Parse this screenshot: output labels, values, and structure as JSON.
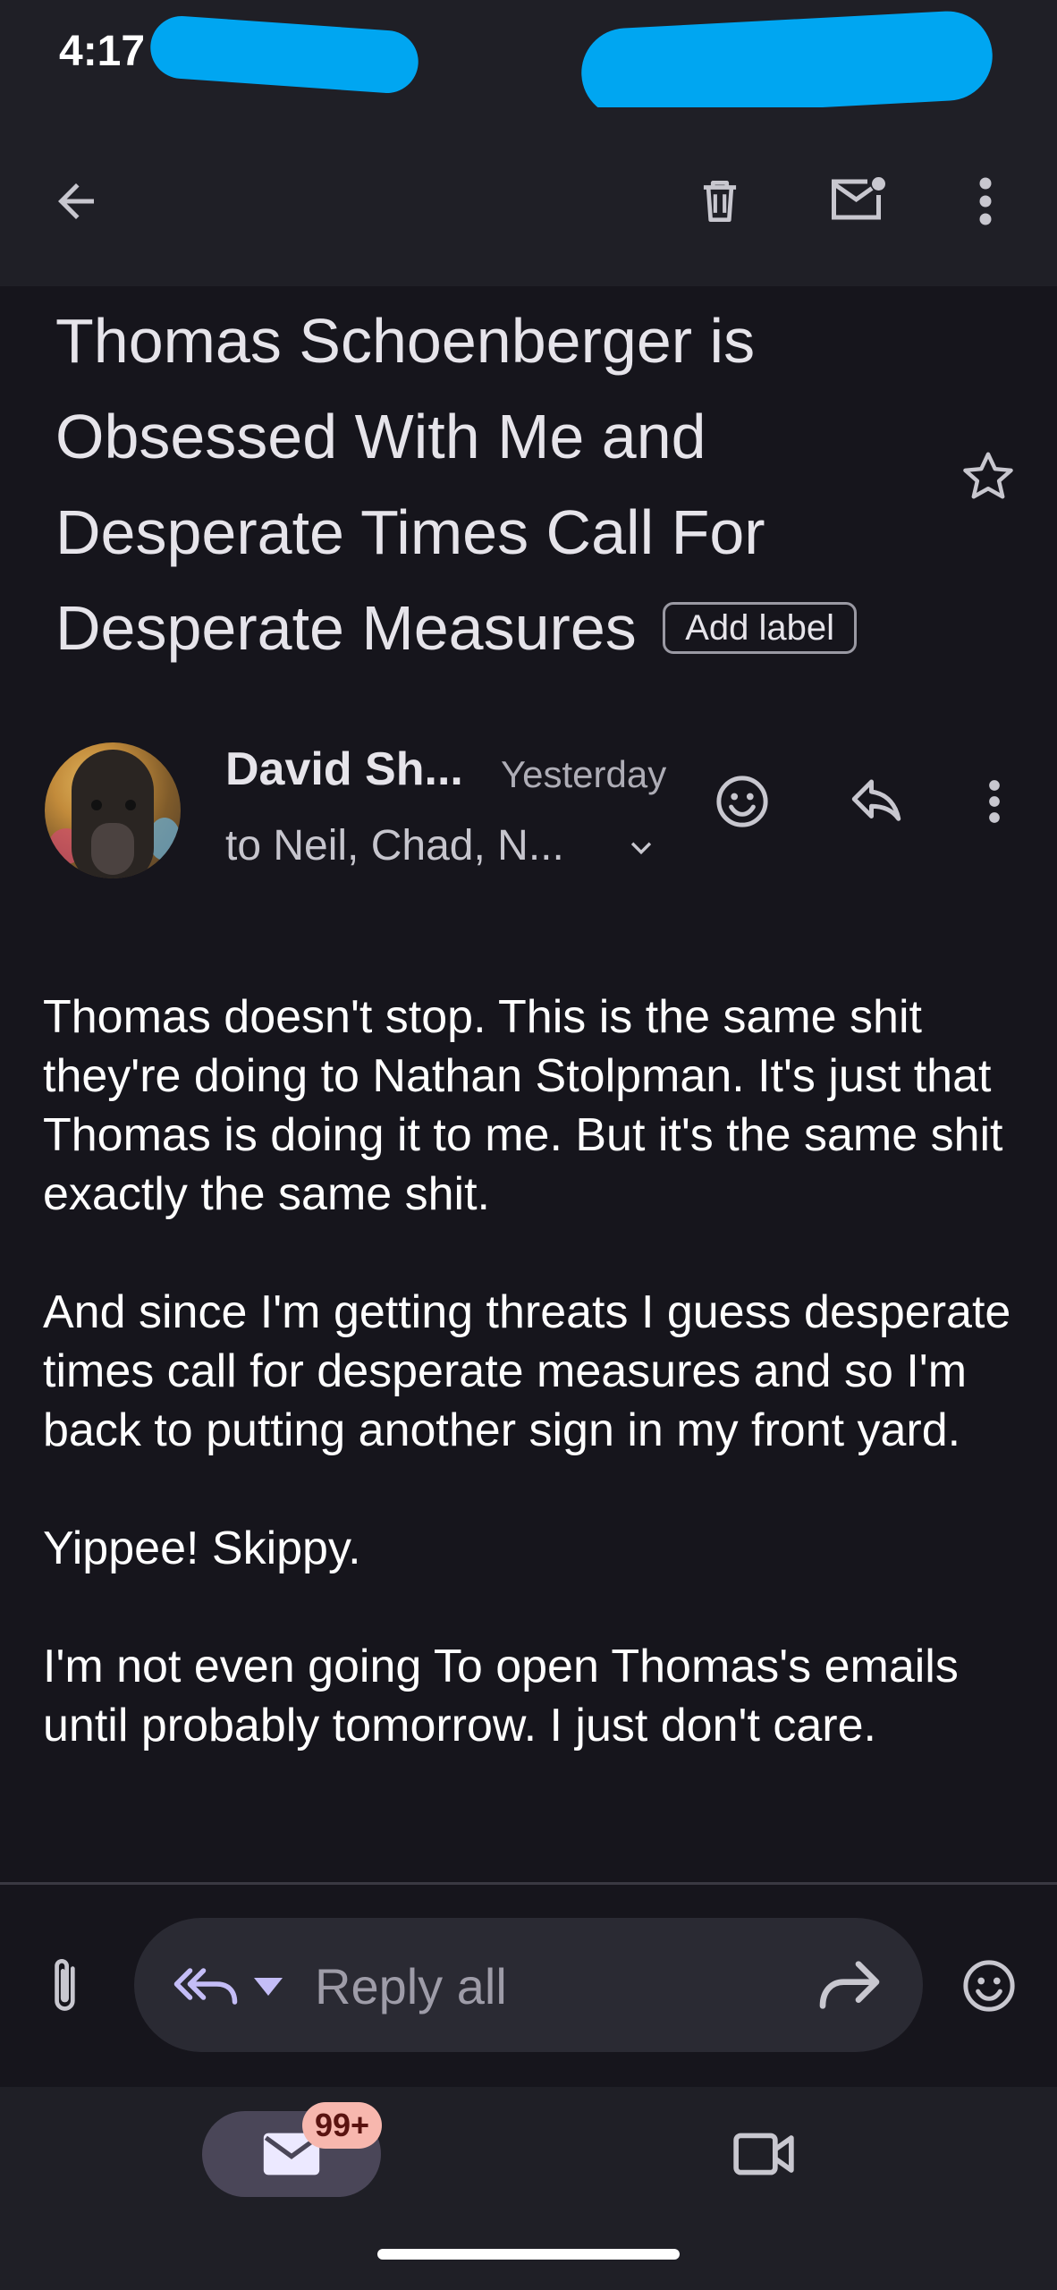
{
  "status_bar": {
    "time": "4:17"
  },
  "toolbar": {
    "back_icon": "arrow-back-icon",
    "delete_icon": "trash-icon",
    "mark_unread_icon": "mail-unread-icon",
    "more_icon": "more-vert-icon"
  },
  "email": {
    "subject": "Thomas Schoenberger is Obsessed With Me and Desperate Times Call For Desperate Measures",
    "add_label": "Add label",
    "sender": {
      "name": "David Sh...",
      "time": "Yesterday",
      "recipients": "to Neil, Chad, N..."
    },
    "body": [
      "Thomas doesn't stop. This is the same shit they're doing to Nathan Stolpman. It's just that Thomas is doing it to me. But it's the same shit exactly the same shit.",
      "And since I'm getting threats I guess desperate times call for desperate measures and so I'm back to putting another sign in my front yard.",
      "Yippee! Skippy.",
      "I'm not even going To open Thomas's emails until probably tomorrow. I just don't care."
    ]
  },
  "reply_bar": {
    "placeholder": "Reply all"
  },
  "bottom_nav": {
    "mail_badge": "99+"
  },
  "colors": {
    "background": "#16151c",
    "bar": "#1f1f26",
    "redaction": "#00a6f1",
    "accent": "#c4bdf7",
    "badge": "#f7b7ae"
  }
}
